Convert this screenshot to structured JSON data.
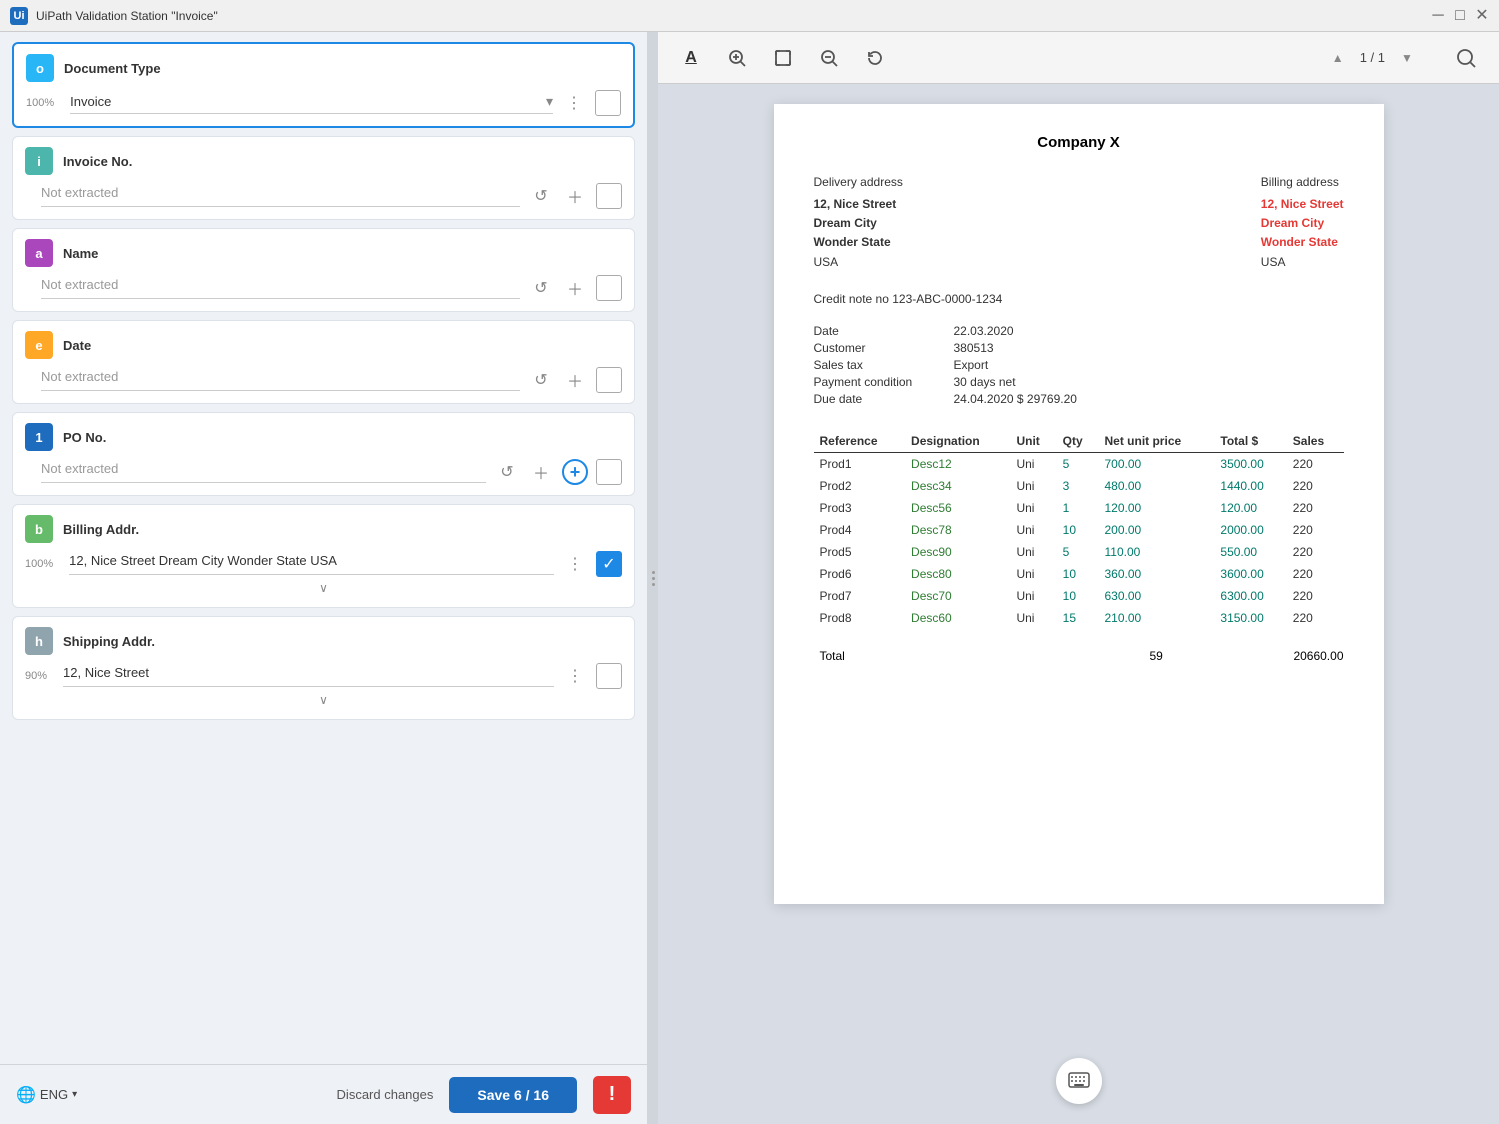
{
  "titleBar": {
    "icon": "Ui",
    "title": "UiPath Validation Station \"Invoice\"",
    "minBtn": "─",
    "maxBtn": "□",
    "closeBtn": "✕"
  },
  "leftPanel": {
    "fields": [
      {
        "id": "document-type",
        "badge": "o",
        "badgeColor": "#29b6f6",
        "label": "Document Type",
        "confidence": "100%",
        "value": "Invoice",
        "hasValue": true,
        "isActive": true,
        "isDropdown": true,
        "showMenu": true,
        "showCheckbox": true,
        "checkboxChecked": false
      },
      {
        "id": "invoice-no",
        "badge": "i",
        "badgeColor": "#4db6ac",
        "label": "Invoice No.",
        "confidence": "",
        "value": "Not extracted",
        "hasValue": false,
        "showUndo": true,
        "showAdd": true,
        "showCheckbox": true,
        "checkboxChecked": false
      },
      {
        "id": "name",
        "badge": "a",
        "badgeColor": "#ab47bc",
        "label": "Name",
        "confidence": "",
        "value": "Not extracted",
        "hasValue": false,
        "showUndo": true,
        "showAdd": true,
        "showCheckbox": true,
        "checkboxChecked": false
      },
      {
        "id": "date",
        "badge": "e",
        "badgeColor": "#ffa726",
        "label": "Date",
        "confidence": "",
        "value": "Not extracted",
        "hasValue": false,
        "showUndo": true,
        "showAdd": true,
        "showCheckbox": true,
        "checkboxChecked": false
      },
      {
        "id": "po-no",
        "badge": "1",
        "badgeColor": "#1e6cbe",
        "label": "PO No.",
        "confidence": "",
        "value": "Not extracted",
        "hasValue": false,
        "showUndo": true,
        "showAdd": true,
        "showCircleAdd": true,
        "showCheckbox": true,
        "checkboxChecked": false
      },
      {
        "id": "billing-addr",
        "badge": "b",
        "badgeColor": "#66bb6a",
        "label": "Billing Addr.",
        "confidence": "100%",
        "value": "12, Nice Street Dream City Wonder State USA",
        "hasValue": true,
        "showMenu": true,
        "showCheckbox": true,
        "checkboxChecked": true,
        "hasExpand": true
      },
      {
        "id": "shipping-addr",
        "badge": "h",
        "badgeColor": "#90a4ae",
        "label": "Shipping Addr.",
        "confidence": "90%",
        "confidenceHigh": true,
        "value": "12, Nice Street",
        "hasValue": true,
        "showMenu": true,
        "showCheckbox": true,
        "checkboxChecked": false,
        "hasExpand": true
      }
    ]
  },
  "bottomBar": {
    "language": "ENG",
    "discardLabel": "Discard changes",
    "saveLabel": "Save 6 / 16",
    "alertIcon": "!"
  },
  "toolbar": {
    "textIcon": "A",
    "zoomInIcon": "🔍",
    "fitIcon": "⛶",
    "zoomOutIcon": "🔍",
    "rotateIcon": "↺",
    "pageInfo": "1 / 1",
    "searchIcon": "🔍"
  },
  "document": {
    "companyName": "Company X",
    "deliveryAddressLabel": "Delivery address",
    "billingAddressLabel": "Billing address",
    "deliveryAddress": {
      "line1": "12, Nice Street",
      "line2": "Dream City",
      "line3": "Wonder State",
      "line4": "USA"
    },
    "billingAddress": {
      "line1": "12, Nice Street",
      "line2": "Dream City",
      "line3": "Wonder State",
      "line4": "USA"
    },
    "creditNoteLabel": "Credit note no 123-ABC-0000-1234",
    "details": [
      {
        "label": "Date",
        "value": "22.03.2020"
      },
      {
        "label": "Customer",
        "value": "380513"
      },
      {
        "label": "Sales tax",
        "value": "Export"
      },
      {
        "label": "Payment condition",
        "value": "30 days net"
      },
      {
        "label": "Due date",
        "value": "24.04.2020 $ 29769.20"
      }
    ],
    "tableHeaders": [
      "Reference",
      "Designation",
      "Unit",
      "Qty",
      "Net unit price",
      "Total $",
      "Sales"
    ],
    "tableRows": [
      {
        "ref": "Prod1",
        "desc": "Desc12",
        "unit": "Uni",
        "qty": "5",
        "price": "700.00",
        "total": "3500.00",
        "sales": "220"
      },
      {
        "ref": "Prod2",
        "desc": "Desc34",
        "unit": "Uni",
        "qty": "3",
        "price": "480.00",
        "total": "1440.00",
        "sales": "220"
      },
      {
        "ref": "Prod3",
        "desc": "Desc56",
        "unit": "Uni",
        "qty": "1",
        "price": "120.00",
        "total": "120.00",
        "sales": "220"
      },
      {
        "ref": "Prod4",
        "desc": "Desc78",
        "unit": "Uni",
        "qty": "10",
        "price": "200.00",
        "total": "2000.00",
        "sales": "220"
      },
      {
        "ref": "Prod5",
        "desc": "Desc90",
        "unit": "Uni",
        "qty": "5",
        "price": "110.00",
        "total": "550.00",
        "sales": "220"
      },
      {
        "ref": "Prod6",
        "desc": "Desc80",
        "unit": "Uni",
        "qty": "10",
        "price": "360.00",
        "total": "3600.00",
        "sales": "220"
      },
      {
        "ref": "Prod7",
        "desc": "Desc70",
        "unit": "Uni",
        "qty": "10",
        "price": "630.00",
        "total": "6300.00",
        "sales": "220"
      },
      {
        "ref": "Prod8",
        "desc": "Desc60",
        "unit": "Uni",
        "qty": "15",
        "price": "210.00",
        "total": "3150.00",
        "sales": "220"
      }
    ],
    "totalLabel": "Total",
    "totalQty": "59",
    "totalAmount": "20660.00"
  }
}
